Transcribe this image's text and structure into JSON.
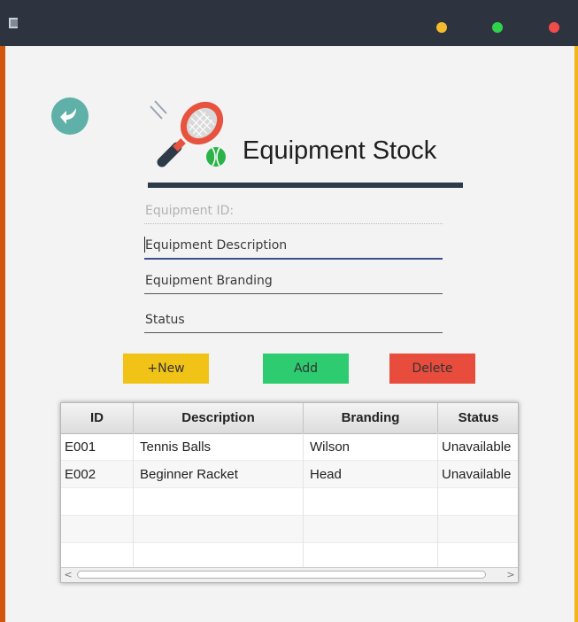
{
  "colors": {
    "titlebar": "#2d3440",
    "minimize": "#f4bd2e",
    "maximize": "#2fd24a",
    "close": "#f24b4b",
    "border_left": "#d1560b",
    "border_right": "#f2b617",
    "new_button": "#f2c317",
    "add_button": "#2ecc71",
    "delete_button": "#e74c3c",
    "back_button": "#5fb0a8"
  },
  "header": {
    "title": "Equipment Stock"
  },
  "form": {
    "id_placeholder": "Equipment ID:",
    "description_placeholder": "Equipment Description",
    "branding_placeholder": "Equipment Branding",
    "status_placeholder": "Status"
  },
  "buttons": {
    "new_label": "+New",
    "add_label": "Add",
    "delete_label": "Delete"
  },
  "table": {
    "columns": [
      "ID",
      "Description",
      "Branding",
      "Status"
    ],
    "rows": [
      [
        "E001",
        "Tennis Balls",
        "Wilson",
        "Unavailable"
      ],
      [
        "E002",
        "Beginner Racket",
        "Head",
        "Unavailable"
      ]
    ],
    "scroll_left": "<",
    "scroll_right": ">"
  }
}
